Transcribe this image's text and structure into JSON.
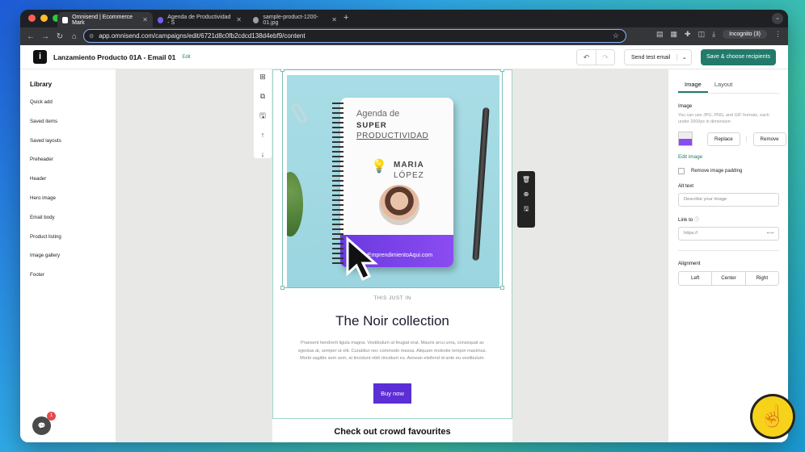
{
  "browser": {
    "tabs": [
      {
        "title": "Omnisend | Ecommerce Mark",
        "active": true
      },
      {
        "title": "Agenda de Productividad - S",
        "active": false
      },
      {
        "title": "sample-product-1200-01.jpg",
        "active": false
      }
    ],
    "url": "app.omnisend.com/campaigns/edit/6721d8c0fb2cdcd138d4ebf9/content",
    "incognito_label": "Incognito (3)"
  },
  "header": {
    "title": "Lanzamiento Producto 01A - Email 01",
    "edit_label": "Edit",
    "send_test_label": "Send test email",
    "save_label": "Save & choose recipients"
  },
  "library": {
    "heading": "Library",
    "items": [
      "Quick add",
      "Saved items",
      "Saved layouts",
      "Preheader",
      "Header",
      "Hero image",
      "Email body",
      "Product listing",
      "Image gallery",
      "Footer"
    ],
    "chat_badge": "1"
  },
  "hero_image": {
    "line1": "Agenda de",
    "line2": "SUPER",
    "line3": "PRODUCTIVIDAD",
    "name1": "MARIA",
    "name2": "LÓPEZ",
    "url": "TuEmprendimientoAqui.com"
  },
  "email": {
    "eyebrow": "THIS JUST IN",
    "title": "The Noir collection",
    "body": "Praesent hendrerit ligula magna. Vestibulum ut feugiat erat. Mauris arcu urna, consequat ac egestas at, semper ut elit. Curabitur nec commodo massa. Aliquam molestie tempor maximus. Morbi sagittis sem sem, at tincidunt nibh tincidunt eu. Aenean eleifend id ante eu vestibulum.",
    "button": "Buy now",
    "next_section_title": "Check out crowd favourites"
  },
  "panel": {
    "tabs": [
      "Image",
      "Layout"
    ],
    "image_label": "Image",
    "image_hint": "You can use JPG, PNG, and GIF formats, each under 2000px in dimension",
    "replace_label": "Replace",
    "remove_label": "Remove",
    "edit_image_label": "Edit image",
    "remove_padding_label": "Remove image padding",
    "alt_text_label": "Alt text",
    "alt_text_placeholder": "Describe your image",
    "link_label": "Link to",
    "link_placeholder": "https://",
    "alignment_label": "Alignment",
    "alignment_options": [
      "Left",
      "Center",
      "Right"
    ]
  },
  "colors": {
    "accent": "#227a6b",
    "cta": "#5b2ed6"
  }
}
